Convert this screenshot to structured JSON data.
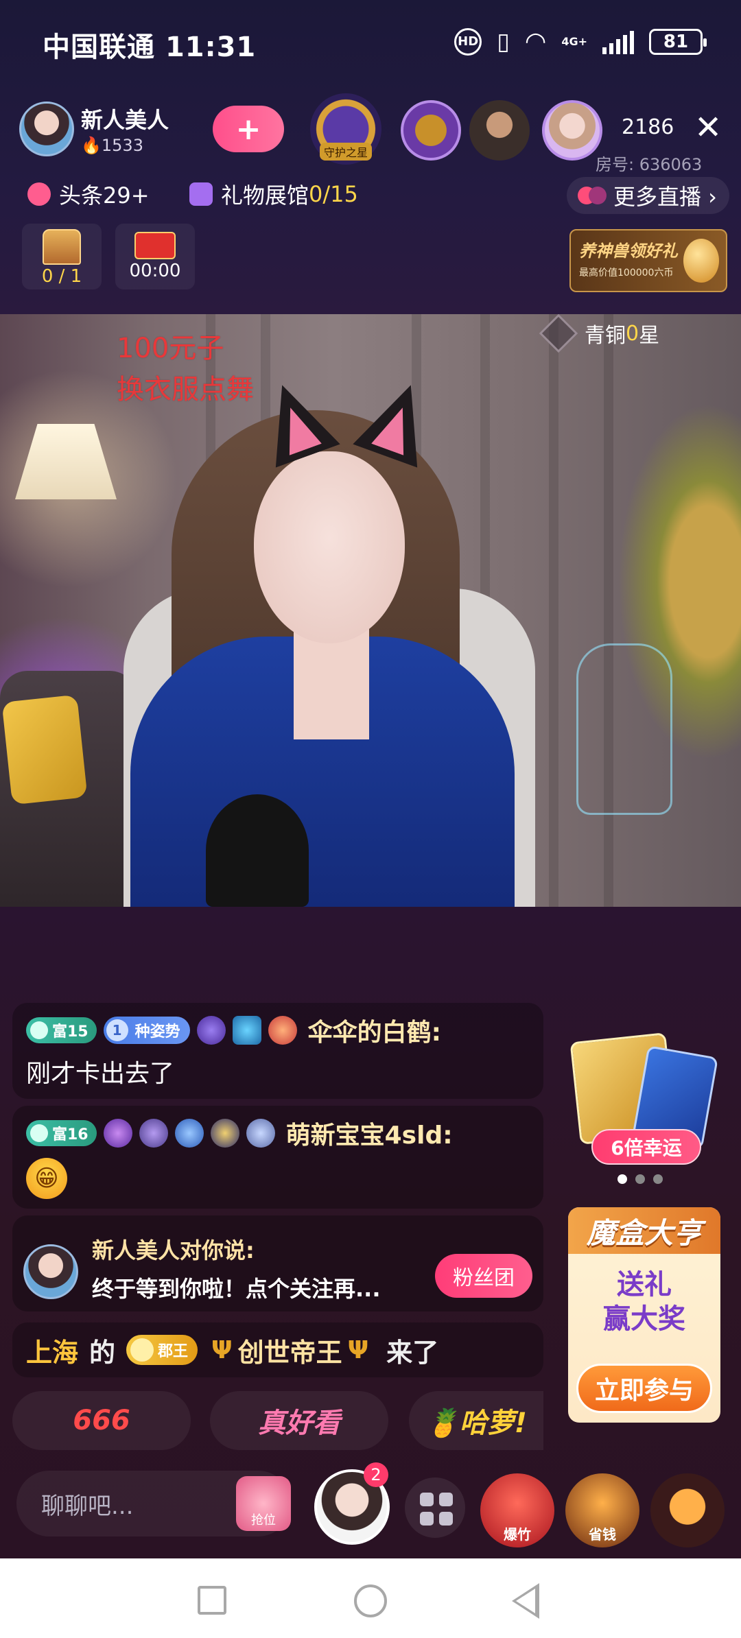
{
  "status_bar": {
    "carrier": "中国联通",
    "time": "11:31",
    "battery": "81",
    "net": "4G+",
    "hd": "HD"
  },
  "host": {
    "name": "新人美人",
    "hot": "🔥1533",
    "follow_icon": "+"
  },
  "guard": {
    "label": "守护之星"
  },
  "viewers": {
    "count": "2186",
    "room_id": "房号: 636063"
  },
  "topbar": {
    "headline": "头条29+",
    "gift_hall_prefix": "礼物展馆 ",
    "gift_hall_count": "0/15",
    "more_live": "更多直播 ›"
  },
  "boxes": {
    "chest_count": "0 / 1",
    "red_pack_timer": "00:00"
  },
  "promo": {
    "title": "养神兽领好礼",
    "subtitle": "最高价值100000六币"
  },
  "video": {
    "overlay_text_1": "100元子",
    "overlay_text_2": "换衣服点舞",
    "rank_prefix": "青铜",
    "rank_num": "0",
    "rank_suffix": "星"
  },
  "chat": {
    "messages": [
      {
        "level": "富15",
        "fan_level": "1",
        "fan_name": "种姿势",
        "user": "伞伞的白鹤:",
        "text": "刚才卡出去了"
      },
      {
        "level": "富16",
        "user": "萌新宝宝4sld:",
        "emoji": "😁"
      }
    ],
    "greet": {
      "title": "新人美人对你说:",
      "message": "终于等到你啦！点个关注再...",
      "button": "粉丝团"
    },
    "enter": {
      "city": "上海",
      "de": "的",
      "title": "郡王",
      "user": "创世帝王",
      "came": "来了"
    }
  },
  "quick_replies": [
    "666",
    "真好看",
    "🍍哈萝!"
  ],
  "side": {
    "lucky_button": "6倍幸运",
    "mohe_title": "魔盒大亨",
    "mohe_line1": "送礼",
    "mohe_line2": "赢大奖",
    "mohe_join": "立即参与"
  },
  "bottom": {
    "placeholder": "聊聊吧...",
    "seat_label": "抢位",
    "anchor_badge": "2",
    "firecracker": "爆竹",
    "save_money": "省钱"
  }
}
